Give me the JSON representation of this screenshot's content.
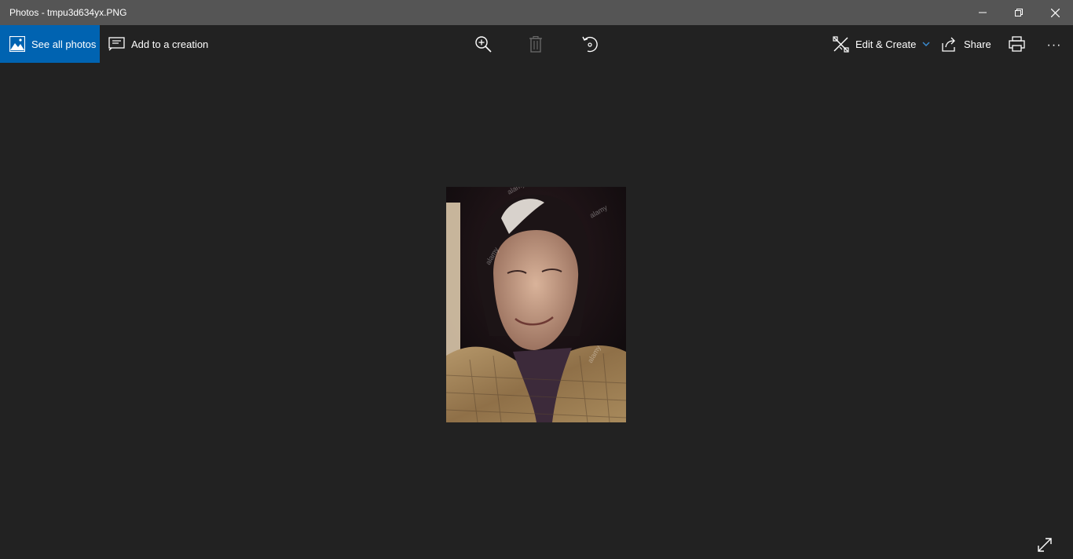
{
  "window": {
    "title": "Photos - tmpu3d634yx.PNG"
  },
  "toolbar": {
    "see_all_label": "See all photos",
    "add_to_creation_label": "Add to a creation",
    "edit_create_label": "Edit & Create",
    "share_label": "Share",
    "more_label": "···"
  },
  "photo": {
    "watermarks": [
      "alamy",
      "alamy",
      "alamy",
      "alamy"
    ]
  },
  "colors": {
    "accent": "#0063b1",
    "background": "#222222",
    "titlebar": "#555555",
    "disabled_icon": "#6b6b6b"
  }
}
